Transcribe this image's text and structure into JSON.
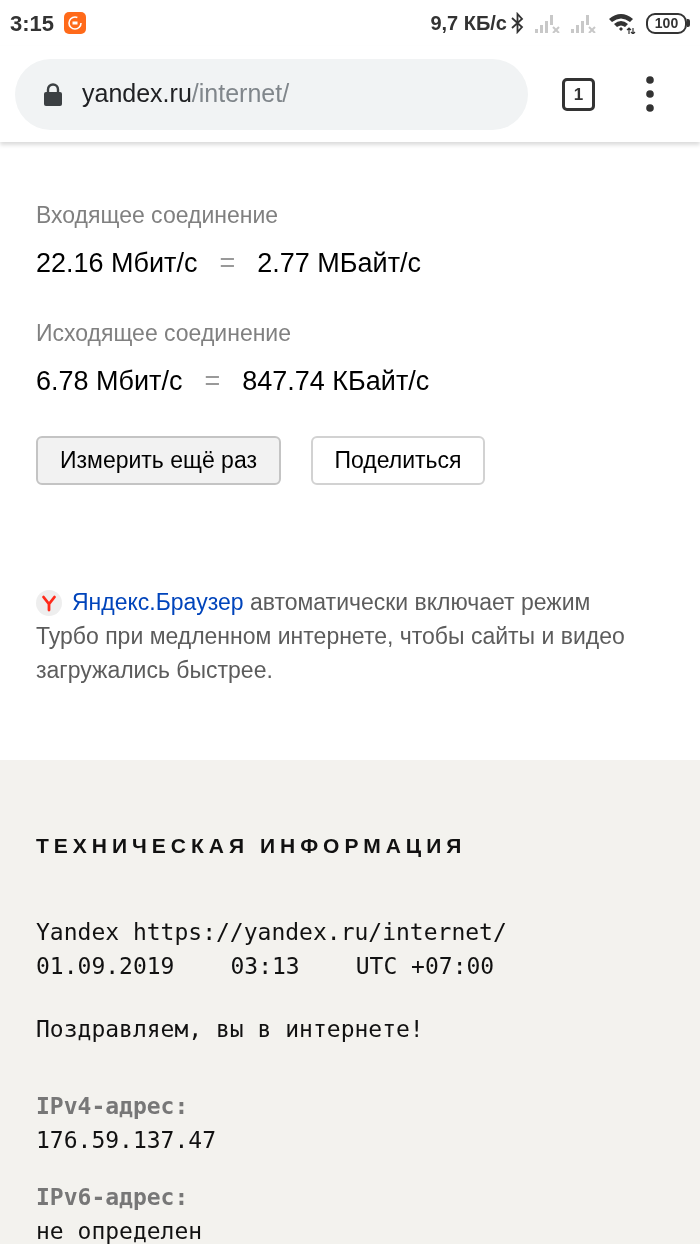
{
  "status_bar": {
    "time": "3:15",
    "network_speed": "9,7 КБ/с",
    "battery": "100"
  },
  "address_bar": {
    "domain": "yandex.ru",
    "path": "/internet/",
    "tab_count": "1"
  },
  "connections": [
    {
      "label": "Входящее соединение",
      "bits": "22.16 Мбит/с",
      "equals": "=",
      "bytes": "2.77 МБайт/с"
    },
    {
      "label": "Исходящее соединение",
      "bits": "6.78 Мбит/с",
      "equals": "=",
      "bytes": "847.74 КБайт/с"
    }
  ],
  "buttons": [
    {
      "label": "Измерить ещё раз",
      "kind": "primary"
    },
    {
      "label": "Поделиться",
      "kind": "secondary"
    }
  ],
  "turbo_note": {
    "link": "Яндекс.Браузер",
    "text": "автоматически включает режим Турбо при медленном интернете, чтобы сайты и видео загружались быстрее."
  },
  "technical_info": {
    "title": "ТЕХНИЧЕСКАЯ ИНФОРМАЦИЯ",
    "source": "Yandex https://yandex.ru/internet/",
    "date": "01.09.2019",
    "time": "03:13",
    "timezone": "UTC +07:00",
    "greeting": "Поздравляем, вы в интернете!",
    "fields": [
      {
        "label": "IPv4-адрес:",
        "value": "176.59.137.47"
      },
      {
        "label": "IPv6-адрес:",
        "value": "не определен"
      }
    ]
  }
}
